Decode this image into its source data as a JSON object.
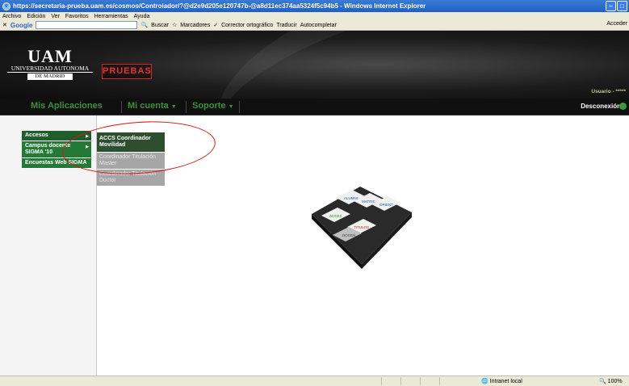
{
  "window": {
    "title": "https://secretaria-prueba.uam.es/cosmos/Controlador/?@d2e9d205e120747b-@a8d11ec374aa5324f5c94b5 - Windows Internet Explorer"
  },
  "menubar": {
    "items": [
      "Archivo",
      "Edición",
      "Ver",
      "Favoritos",
      "Herramientas",
      "Ayuda"
    ]
  },
  "google_toolbar": {
    "logo": "Google",
    "items": [
      "Buscar",
      "Marcadores",
      "Corrector ortográfico",
      "Traducir",
      "Autocompletar"
    ],
    "right_label": "Acceder"
  },
  "header": {
    "logo_mark": "UAM",
    "logo_name": "UNIVERSIDAD AUTONOMA",
    "logo_city": "DE MADRID",
    "environment_badge": "PRUEBAS",
    "user_label": "Usuario - *****"
  },
  "navbar": {
    "items": [
      "Mis Aplicaciones",
      "Mi cuenta",
      "Soporte"
    ],
    "logout": "Desconexión"
  },
  "side_menu": {
    "items": [
      "Accesos",
      "Campus docente SIGMA '10",
      "Encuestas Web SIGMA"
    ]
  },
  "sub_menu": {
    "items": [
      "ACCS Coordinador Movilidad",
      "Coordinador Titulación Master",
      "Coordinador Titulación Doctor"
    ]
  },
  "puzzle": {
    "pieces": [
      "ALUMNI",
      "MATRIC",
      "ORIENT",
      "DOCEN",
      "ACCES",
      "TITULOS"
    ]
  },
  "statusbar": {
    "zone": "Intranet local",
    "zoom": "100%"
  },
  "colors": {
    "nav_green": "#3d8f3d",
    "menu_green": "#237a37",
    "badge_red": "#e83030",
    "highlight": "#e01414"
  }
}
